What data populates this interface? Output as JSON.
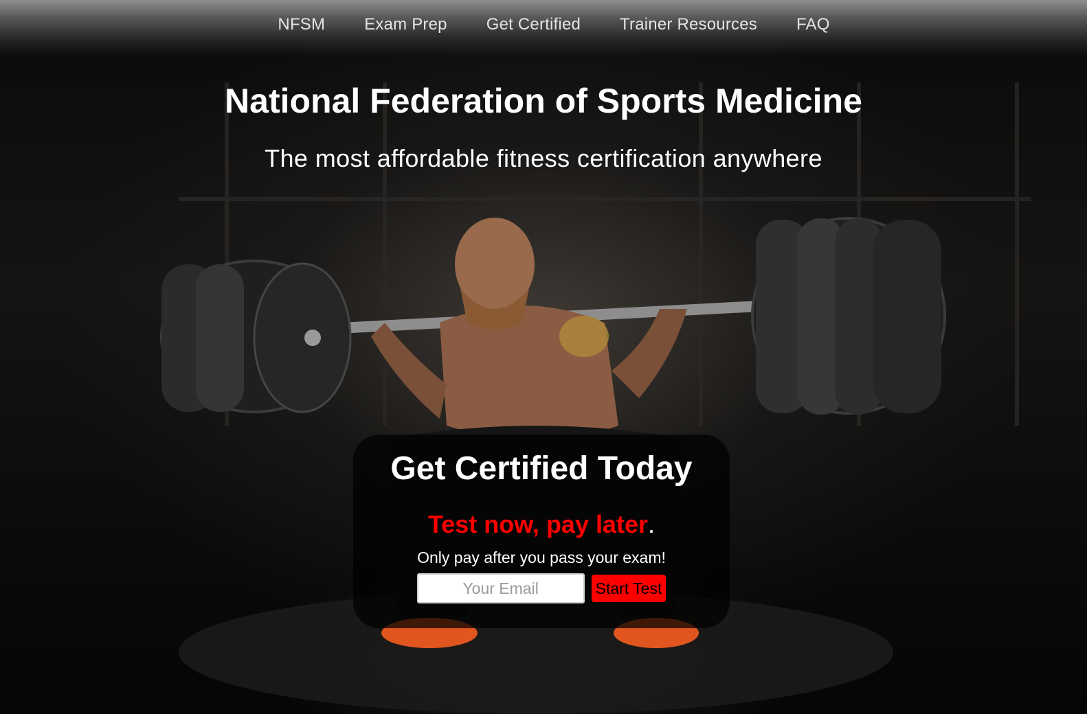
{
  "nav": {
    "items": [
      {
        "label": "NFSM"
      },
      {
        "label": "Exam Prep"
      },
      {
        "label": "Get Certified"
      },
      {
        "label": "Trainer Resources"
      },
      {
        "label": "FAQ"
      }
    ]
  },
  "hero": {
    "title": "National Federation of Sports Medicine",
    "subtitle": "The most affordable fitness certification anywhere"
  },
  "cta": {
    "heading": "Get Certified Today",
    "tagline_red": "Test now, pay later",
    "tagline_end": ".",
    "note": "Only pay after you pass your exam!",
    "email_placeholder": "Your Email",
    "email_value": "",
    "button_label": "Start Test"
  },
  "colors": {
    "accent": "#ff0000",
    "text": "#ffffff",
    "nav_text": "#e4e4e4"
  }
}
